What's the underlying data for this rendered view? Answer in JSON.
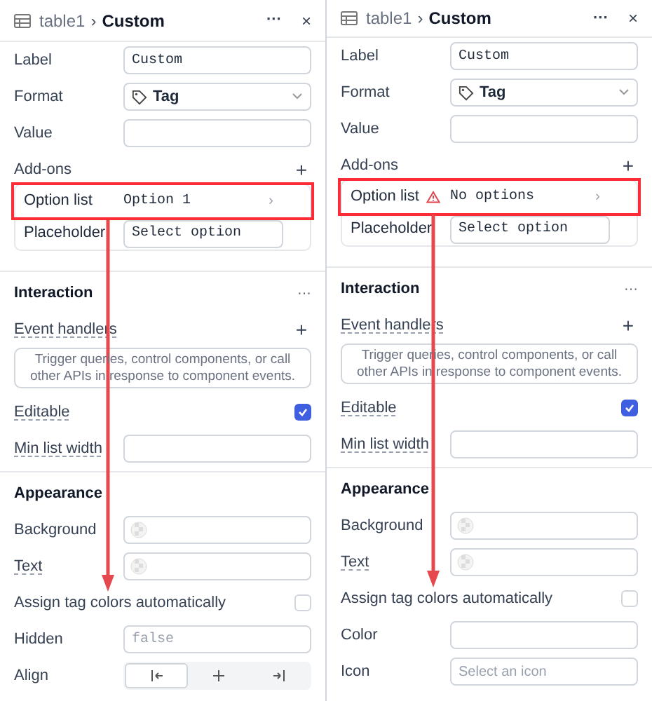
{
  "panels": [
    {
      "breadcrumb": {
        "parent": "table1",
        "separator": "›",
        "current": "Custom"
      },
      "actions": [
        "···",
        "×"
      ],
      "sections": [
        {
          "items": [
            {
              "kind": "input",
              "label": "Label",
              "value": "Custom"
            },
            {
              "kind": "select",
              "label": "Format",
              "value": "Tag"
            },
            {
              "kind": "input",
              "label": "Value"
            },
            {
              "kind": "heading",
              "label": "Add-ons",
              "action": "+"
            },
            {
              "kind": "group",
              "rows": [
                {
                  "kind": "link",
                  "label": "Option list",
                  "value": "Option 1",
                  "chevron": "›",
                  "warning": false,
                  "highlighted": true
                },
                {
                  "kind": "input",
                  "label": "Placeholder",
                  "value": "Select option",
                  "highlighted": false
                }
              ]
            }
          ]
        },
        {
          "title": "Interaction",
          "action": "···",
          "items": [
            {
              "kind": "heading",
              "label": "Event handlers",
              "action": "+",
              "hint": true
            },
            {
              "kind": "textarea",
              "placeholder": "Trigger queries, control components, or call other APIs in response to component events."
            },
            {
              "kind": "checkbox",
              "label": "Editable",
              "checked": true,
              "hint": true
            },
            {
              "kind": "input",
              "label": "Min list width",
              "hint": true
            }
          ]
        },
        {
          "title": "Appearance",
          "items": [
            {
              "kind": "color",
              "label": "Background"
            },
            {
              "kind": "color",
              "label": "Text",
              "hint": true
            },
            {
              "kind": "checkbox",
              "label": "Assign tag colors automatically",
              "checked": false
            },
            {
              "kind": "input",
              "label": "Hidden",
              "placeholder": "false",
              "mono": true
            },
            {
              "kind": "segmented",
              "label": "Align",
              "options": [
                {
                  "kind": "left",
                  "selected": true
                },
                {
                  "kind": "center",
                  "selected": false
                },
                {
                  "kind": "right",
                  "selected": false
                }
              ]
            }
          ]
        }
      ]
    },
    {
      "breadcrumb": {
        "parent": "table1",
        "separator": "›",
        "current": "Custom"
      },
      "actions": [
        "···",
        "×"
      ],
      "sections": [
        {
          "items": [
            {
              "kind": "input",
              "label": "Label",
              "value": "Custom"
            },
            {
              "kind": "select",
              "label": "Format",
              "value": "Tag"
            },
            {
              "kind": "input",
              "label": "Value"
            },
            {
              "kind": "heading",
              "label": "Add-ons",
              "action": "+"
            },
            {
              "kind": "group",
              "rows": [
                {
                  "kind": "link",
                  "label": "Option list",
                  "value": "No options",
                  "chevron": "›",
                  "warning": true,
                  "highlighted": true
                },
                {
                  "kind": "input",
                  "label": "Placeholder",
                  "value": "Select option",
                  "highlighted": false
                }
              ]
            }
          ]
        },
        {
          "title": "Interaction",
          "action": "···",
          "items": [
            {
              "kind": "heading",
              "label": "Event handlers",
              "action": "+",
              "hint": true
            },
            {
              "kind": "textarea",
              "placeholder": "Trigger queries, control components, or call other APIs in response to component events."
            },
            {
              "kind": "checkbox",
              "label": "Editable",
              "checked": true,
              "hint": true
            },
            {
              "kind": "input",
              "label": "Min list width",
              "hint": true
            }
          ]
        },
        {
          "title": "Appearance",
          "items": [
            {
              "kind": "color",
              "label": "Background"
            },
            {
              "kind": "color",
              "label": "Text",
              "hint": true
            },
            {
              "kind": "checkbox",
              "label": "Assign tag colors automatically",
              "checked": false
            },
            {
              "kind": "input",
              "label": "Color"
            },
            {
              "kind": "input",
              "label": "Icon",
              "placeholder": "Select an icon",
              "mono": false
            }
          ]
        }
      ]
    }
  ]
}
